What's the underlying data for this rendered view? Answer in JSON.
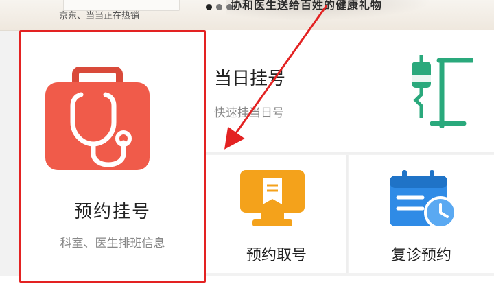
{
  "banner": {
    "left_text": "京东、当当正在热销",
    "center_text": "协和医生送给百姓的健康礼物"
  },
  "services": {
    "main": {
      "title": "预约挂号",
      "subtitle": "科室、医生排班信息",
      "icon": "medical-kit-stethoscope-icon",
      "color": "#f05b4a"
    },
    "today": {
      "title": "当日挂号",
      "subtitle": "快速挂当日号",
      "icon": "iv-drip-icon",
      "color": "#2aa97c"
    },
    "ticket": {
      "title": "预约取号",
      "icon": "monitor-ticket-icon",
      "color": "#f4a21b"
    },
    "revisit": {
      "title": "复诊预约",
      "icon": "calendar-clock-icon",
      "color": "#2f8be6"
    }
  },
  "annotation": {
    "highlight_color": "#e32222"
  }
}
